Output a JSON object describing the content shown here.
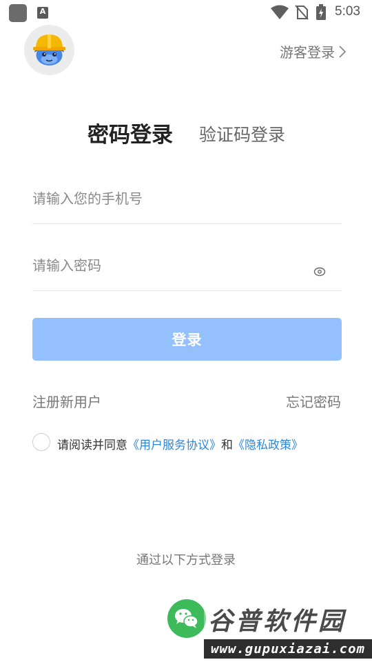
{
  "status_bar": {
    "time": "5:03",
    "icons": [
      "app-icon",
      "a-icon",
      "wifi-icon",
      "no-sim-icon",
      "battery-charging-icon"
    ],
    "a_icon_label": "A"
  },
  "header": {
    "avatar_icon": "helmet-mascot-icon",
    "guest_login_label": "游客登录"
  },
  "tabs": [
    {
      "label": "密码登录",
      "active": true
    },
    {
      "label": "验证码登录",
      "active": false
    }
  ],
  "form": {
    "phone_placeholder": "请输入您的手机号",
    "password_placeholder": "请输入密码",
    "login_button_label": "登录",
    "register_label": "注册新用户",
    "forgot_label": "忘记密码"
  },
  "agreement": {
    "prefix": "请阅读并同意",
    "terms_link": "《用户服务协议》",
    "conjunction": "和",
    "privacy_link": "《隐私政策》",
    "link_color": "#2f86d8"
  },
  "other_login": {
    "title": "通过以下方式登录",
    "methods": [
      {
        "icon": "wechat-icon",
        "color": "#3dbb5b"
      }
    ]
  },
  "watermark": {
    "title": "谷普软件园",
    "url": "www.gupuxiazai.com"
  },
  "colors": {
    "login_button": "#94c1fd",
    "text_primary": "#222222",
    "text_secondary": "#777777"
  }
}
